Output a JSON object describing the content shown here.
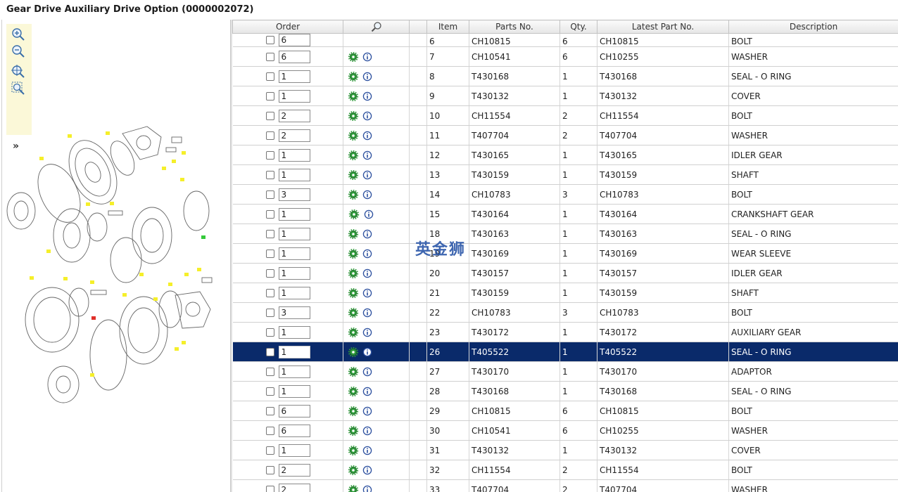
{
  "title": "Gear Drive Auxiliary Drive Option (0000002072)",
  "zoom_toolbar": [
    "zoom-in-icon",
    "zoom-out-icon",
    "zoom-fit-icon",
    "zoom-window-icon"
  ],
  "expand_label": "»",
  "columns": [
    "Order",
    "",
    "Item",
    "Parts No.",
    "Qty.",
    "Latest Part No.",
    "Description"
  ],
  "search_icon": "magnifier-icon",
  "top_partial_row": {
    "qty": "6",
    "item": "6",
    "parts_no": "CH10815",
    "qty_val": "6",
    "latest": "CH10815",
    "desc": "BOLT"
  },
  "rows": [
    {
      "order_qty": "6",
      "item": "7",
      "parts_no": "CH10541",
      "qty": "6",
      "latest": "CH10255",
      "desc": "WASHER"
    },
    {
      "order_qty": "1",
      "item": "8",
      "parts_no": "T430168",
      "qty": "1",
      "latest": "T430168",
      "desc": "SEAL - O RING"
    },
    {
      "order_qty": "1",
      "item": "9",
      "parts_no": "T430132",
      "qty": "1",
      "latest": "T430132",
      "desc": "COVER"
    },
    {
      "order_qty": "2",
      "item": "10",
      "parts_no": "CH11554",
      "qty": "2",
      "latest": "CH11554",
      "desc": "BOLT"
    },
    {
      "order_qty": "2",
      "item": "11",
      "parts_no": "T407704",
      "qty": "2",
      "latest": "T407704",
      "desc": "WASHER"
    },
    {
      "order_qty": "1",
      "item": "12",
      "parts_no": "T430165",
      "qty": "1",
      "latest": "T430165",
      "desc": "IDLER GEAR"
    },
    {
      "order_qty": "1",
      "item": "13",
      "parts_no": "T430159",
      "qty": "1",
      "latest": "T430159",
      "desc": "SHAFT"
    },
    {
      "order_qty": "3",
      "item": "14",
      "parts_no": "CH10783",
      "qty": "3",
      "latest": "CH10783",
      "desc": "BOLT"
    },
    {
      "order_qty": "1",
      "item": "15",
      "parts_no": "T430164",
      "qty": "1",
      "latest": "T430164",
      "desc": "CRANKSHAFT GEAR"
    },
    {
      "order_qty": "1",
      "item": "18",
      "parts_no": "T430163",
      "qty": "1",
      "latest": "T430163",
      "desc": "SEAL - O RING"
    },
    {
      "order_qty": "1",
      "item": "19",
      "parts_no": "T430169",
      "qty": "1",
      "latest": "T430169",
      "desc": "WEAR SLEEVE"
    },
    {
      "order_qty": "1",
      "item": "20",
      "parts_no": "T430157",
      "qty": "1",
      "latest": "T430157",
      "desc": "IDLER GEAR"
    },
    {
      "order_qty": "1",
      "item": "21",
      "parts_no": "T430159",
      "qty": "1",
      "latest": "T430159",
      "desc": "SHAFT"
    },
    {
      "order_qty": "3",
      "item": "22",
      "parts_no": "CH10783",
      "qty": "3",
      "latest": "CH10783",
      "desc": "BOLT"
    },
    {
      "order_qty": "1",
      "item": "23",
      "parts_no": "T430172",
      "qty": "1",
      "latest": "T430172",
      "desc": "AUXILIARY GEAR"
    },
    {
      "order_qty": "1",
      "item": "26",
      "parts_no": "T405522",
      "qty": "1",
      "latest": "T405522",
      "desc": "SEAL - O RING",
      "selected": true
    },
    {
      "order_qty": "1",
      "item": "27",
      "parts_no": "T430170",
      "qty": "1",
      "latest": "T430170",
      "desc": "ADAPTOR"
    },
    {
      "order_qty": "1",
      "item": "28",
      "parts_no": "T430168",
      "qty": "1",
      "latest": "T430168",
      "desc": "SEAL - O RING"
    },
    {
      "order_qty": "6",
      "item": "29",
      "parts_no": "CH10815",
      "qty": "6",
      "latest": "CH10815",
      "desc": "BOLT"
    },
    {
      "order_qty": "6",
      "item": "30",
      "parts_no": "CH10541",
      "qty": "6",
      "latest": "CH10255",
      "desc": "WASHER"
    },
    {
      "order_qty": "1",
      "item": "31",
      "parts_no": "T430132",
      "qty": "1",
      "latest": "T430132",
      "desc": "COVER"
    },
    {
      "order_qty": "2",
      "item": "32",
      "parts_no": "CH11554",
      "qty": "2",
      "latest": "CH11554",
      "desc": "BOLT"
    },
    {
      "order_qty": "2",
      "item": "33",
      "parts_no": "T407704",
      "qty": "2",
      "latest": "T407704",
      "desc": "WASHER"
    }
  ],
  "watermark": "英金狮",
  "diagram_callouts": [
    "1",
    "2",
    "3",
    "4",
    "5",
    "6",
    "7",
    "8",
    "9",
    "10",
    "11",
    "12",
    "13",
    "14",
    "15",
    "16",
    "17",
    "18",
    "19",
    "20",
    "21",
    "22",
    "23",
    "24",
    "25",
    "26",
    "27",
    "28",
    "29",
    "30",
    "31",
    "32",
    "33"
  ],
  "colors": {
    "selected_row": "#0a2a6a",
    "toolbar_bg": "#fbf8d8",
    "callout_yellow": "#f5ef2a",
    "callout_green": "#35c93a",
    "callout_red": "#e0302a"
  }
}
